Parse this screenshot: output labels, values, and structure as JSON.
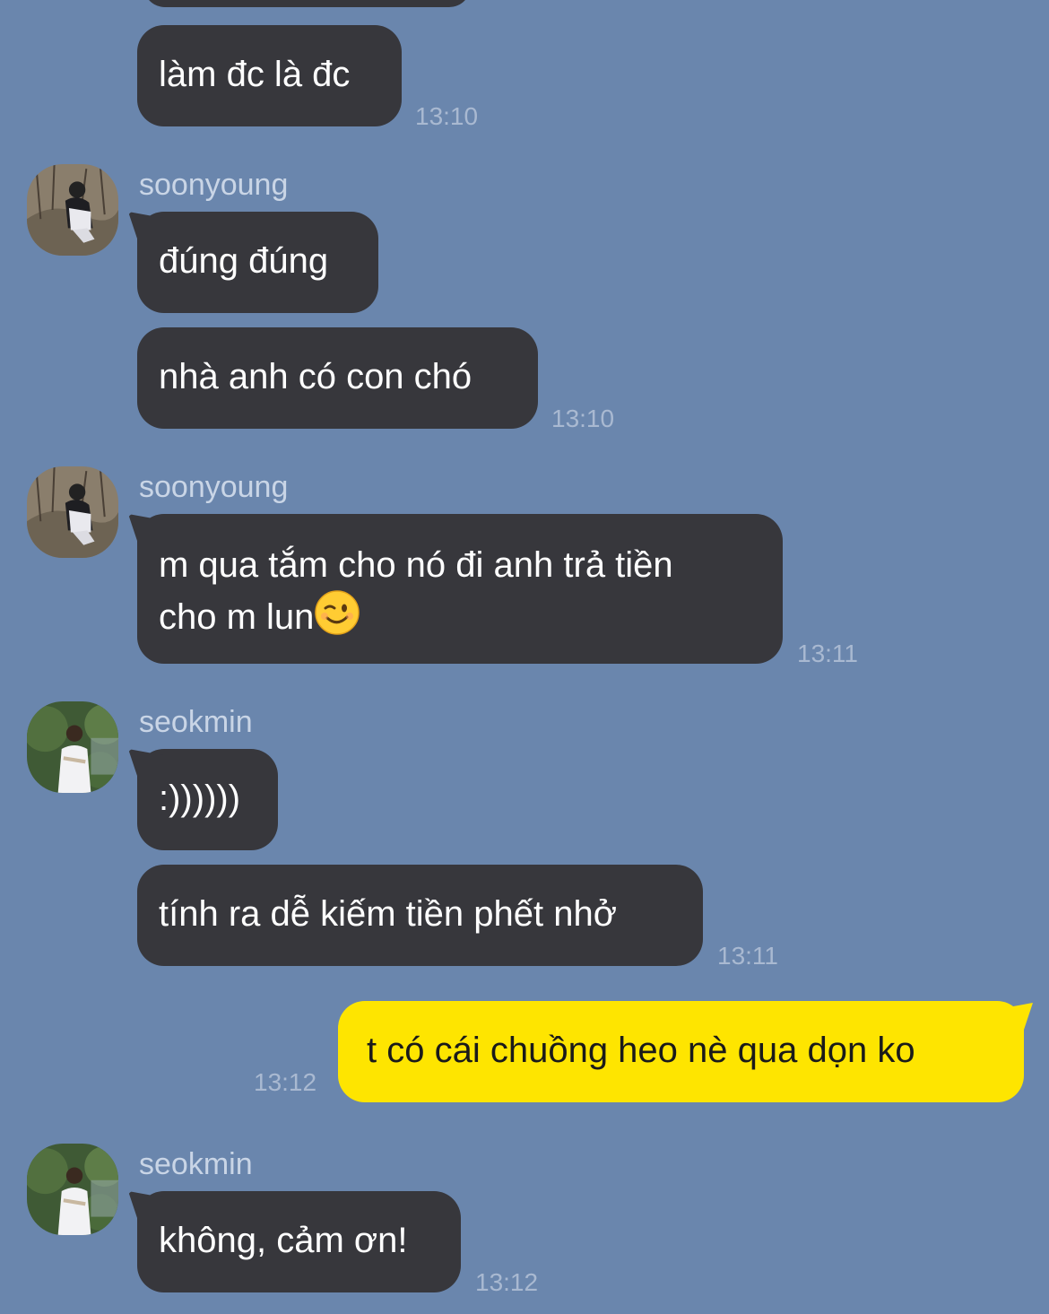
{
  "messages": [
    {
      "text": "làm đc là đc",
      "time": "13:10"
    },
    {
      "sender": "soonyoung",
      "text": "đúng đúng"
    },
    {
      "text": "nhà anh có con chó",
      "time": "13:10"
    },
    {
      "sender": "soonyoung",
      "text_line1": "m qua tắm cho nó đi anh trả tiền",
      "text_line2": "cho m lun",
      "emoji": "winking-face",
      "time": "13:11"
    },
    {
      "sender": "seokmin",
      "text": ":))))))"
    },
    {
      "text": "tính ra dễ kiếm tiền phết nhở",
      "time": "13:11"
    },
    {
      "sender": "me",
      "text": "t có cái chuồng heo nè qua dọn ko",
      "time": "13:12"
    },
    {
      "sender": "seokmin",
      "text": "không, cảm ơn!",
      "time": "13:12"
    }
  ],
  "colors": {
    "background": "#6a86ad",
    "incoming_bubble": "#37373c",
    "outgoing_bubble": "#fee500"
  }
}
